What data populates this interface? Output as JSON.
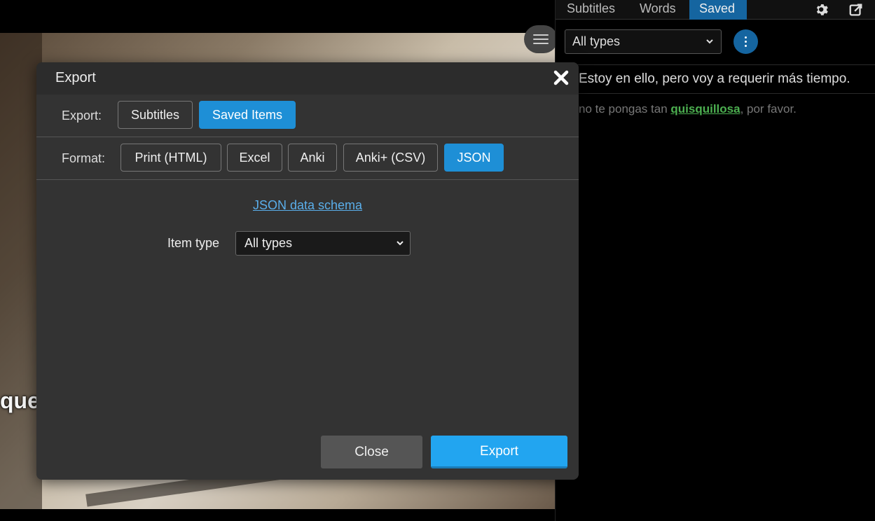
{
  "video": {
    "subtitle_fragment": "que"
  },
  "panel": {
    "tabs": [
      {
        "label": "Subtitles"
      },
      {
        "label": "Words"
      },
      {
        "label": "Saved"
      }
    ],
    "icons": [
      "gear-icon",
      "external-edit-icon"
    ],
    "filter_select": "All types",
    "subtitle_line_1": "Estoy en ello, pero voy a requerir más tiempo.",
    "subtitle_line_2": {
      "before": "no te pongas tan ",
      "highlight": "quisquillosa",
      "after": ", por favor."
    }
  },
  "modal": {
    "title": "Export",
    "export_label": "Export:",
    "export_options": [
      {
        "label": "Subtitles",
        "active": false
      },
      {
        "label": "Saved Items",
        "active": true
      }
    ],
    "format_label": "Format:",
    "format_options": [
      {
        "label": "Print (HTML)",
        "active": false
      },
      {
        "label": "Excel",
        "active": false
      },
      {
        "label": "Anki",
        "active": false
      },
      {
        "label": "Anki+ (CSV)",
        "active": false
      },
      {
        "label": "JSON",
        "active": true
      }
    ],
    "schema_link": "JSON data schema",
    "item_type_label": "Item type",
    "item_type_value": "All types",
    "close_label": "Close",
    "export_button_label": "Export"
  },
  "colors": {
    "accent": "#1e8fd6",
    "export_button": "#22a5f0",
    "highlight_word": "#4caf50",
    "link": "#5aaeea"
  }
}
